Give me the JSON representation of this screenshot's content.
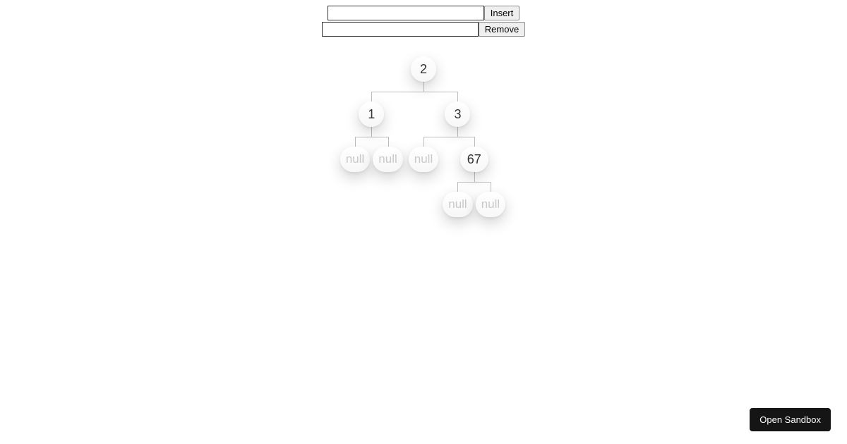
{
  "controls": {
    "insert": {
      "label": "Insert",
      "value": ""
    },
    "remove": {
      "label": "Remove",
      "value": ""
    }
  },
  "null_label": "null",
  "tree": {
    "value": "2",
    "left": {
      "value": "1",
      "left": null,
      "right": null
    },
    "right": {
      "value": "3",
      "left": null,
      "right": {
        "value": "67",
        "left": null,
        "right": null
      }
    }
  },
  "footer": {
    "open_sandbox": "Open Sandbox"
  }
}
